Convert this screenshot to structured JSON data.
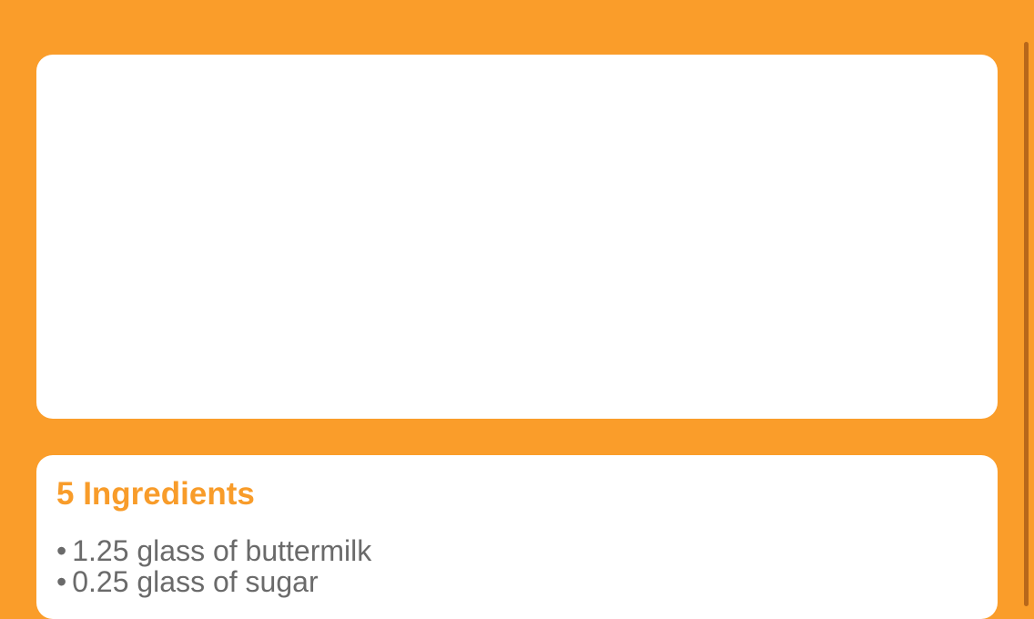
{
  "colors": {
    "background": "#FA9D2A",
    "card": "#FFFFFF",
    "accent": "#F89C2A",
    "text": "#6A6A6A",
    "scrollbar": "#B8671A"
  },
  "ingredients": {
    "title": "5 Ingredients",
    "bullet": "•",
    "items": [
      "1.25 glass of buttermilk",
      "0.25 glass of sugar"
    ]
  }
}
